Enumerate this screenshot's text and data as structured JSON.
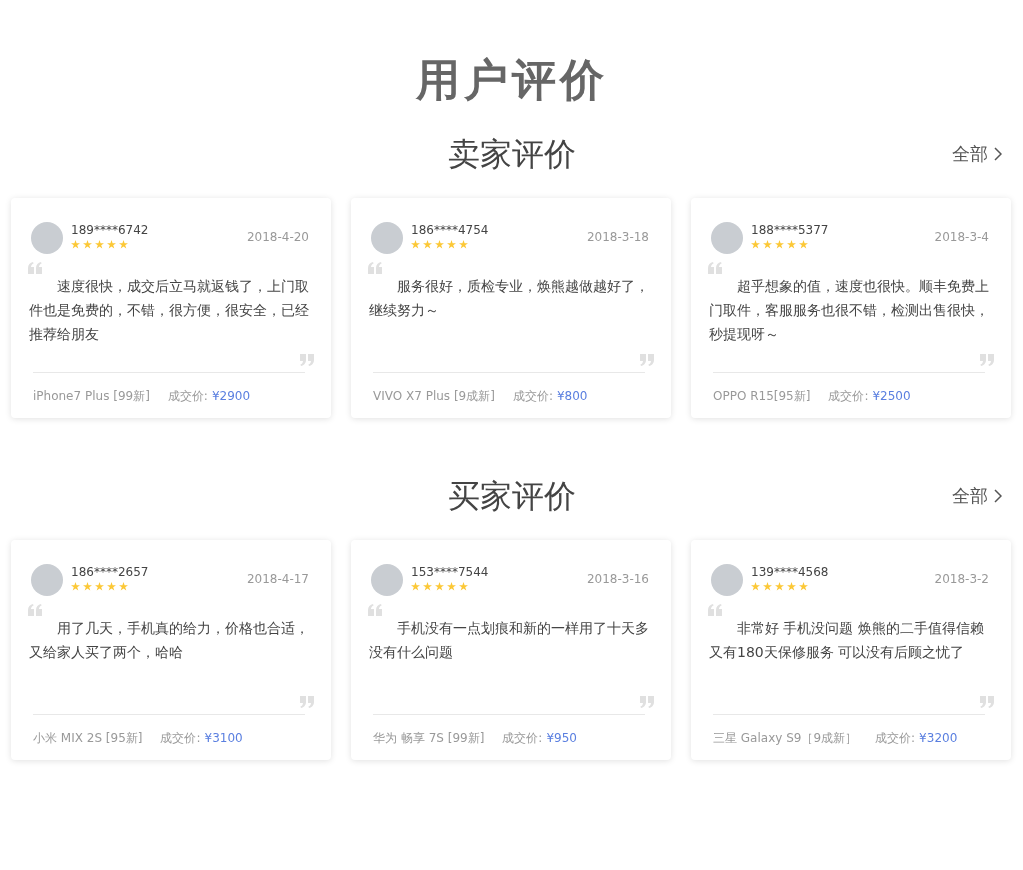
{
  "title": "用户评价",
  "sections": [
    {
      "heading": "卖家评价",
      "more": "全部",
      "reviews": [
        {
          "user": "189****6742",
          "stars": 5,
          "date": "2018-4-20",
          "text": "速度很快，成交后立马就返钱了，上门取件也是免费的，不错，很方便，很安全，已经推荐给朋友",
          "product": "iPhone7 Plus [99新]",
          "price_label": "成交价:",
          "price": "¥2900"
        },
        {
          "user": "186****4754",
          "stars": 5,
          "date": "2018-3-18",
          "text": "服务很好，质检专业，焕熊越做越好了，继续努力～",
          "product": "VIVO X7 Plus [9成新]",
          "price_label": "成交价:",
          "price": "¥800"
        },
        {
          "user": "188****5377",
          "stars": 5,
          "date": "2018-3-4",
          "text": "超乎想象的值，速度也很快。顺丰免费上门取件，客服服务也很不错，检测出售很快，秒提现呀～",
          "product": "OPPO R15[95新]",
          "price_label": "成交价:",
          "price": "¥2500"
        }
      ]
    },
    {
      "heading": "买家评价",
      "more": "全部",
      "reviews": [
        {
          "user": "186****2657",
          "stars": 5,
          "date": "2018-4-17",
          "text": "用了几天，手机真的给力，价格也合适，又给家人买了两个，哈哈",
          "product": "小米 MIX 2S [95新]",
          "price_label": "成交价:",
          "price": "¥3100"
        },
        {
          "user": "153****7544",
          "stars": 5,
          "date": "2018-3-16",
          "text": "手机没有一点划痕和新的一样用了十天多没有什么问题",
          "product": "华为 畅享 7S [99新]",
          "price_label": "成交价:",
          "price": "¥950"
        },
        {
          "user": "139****4568",
          "stars": 5,
          "date": "2018-3-2",
          "text": "非常好 手机没问题 焕熊的二手值得信赖又有180天保修服务 可以没有后顾之忧了",
          "product": "三星 Galaxy S9［9成新］",
          "price_label": "成交价:",
          "price": "¥3200"
        }
      ]
    }
  ]
}
